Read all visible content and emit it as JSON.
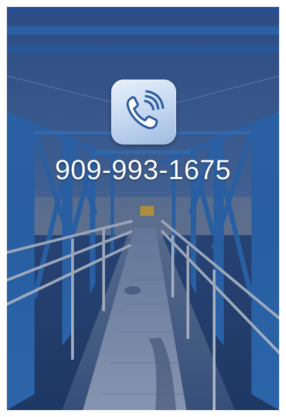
{
  "call_screen": {
    "phone_number": "909-993-1675",
    "call_icon": "phone-calling-icon",
    "background_image": "industrial-walkway-photo"
  },
  "colors": {
    "sky_tint": "#2b4f8a",
    "steel_blue": "#2f6fb8",
    "walkway_grey": "#8a97ad",
    "button_light": "#e9f1fb",
    "icon_blue": "#2a5aa0",
    "number_text": "#ffffff"
  }
}
